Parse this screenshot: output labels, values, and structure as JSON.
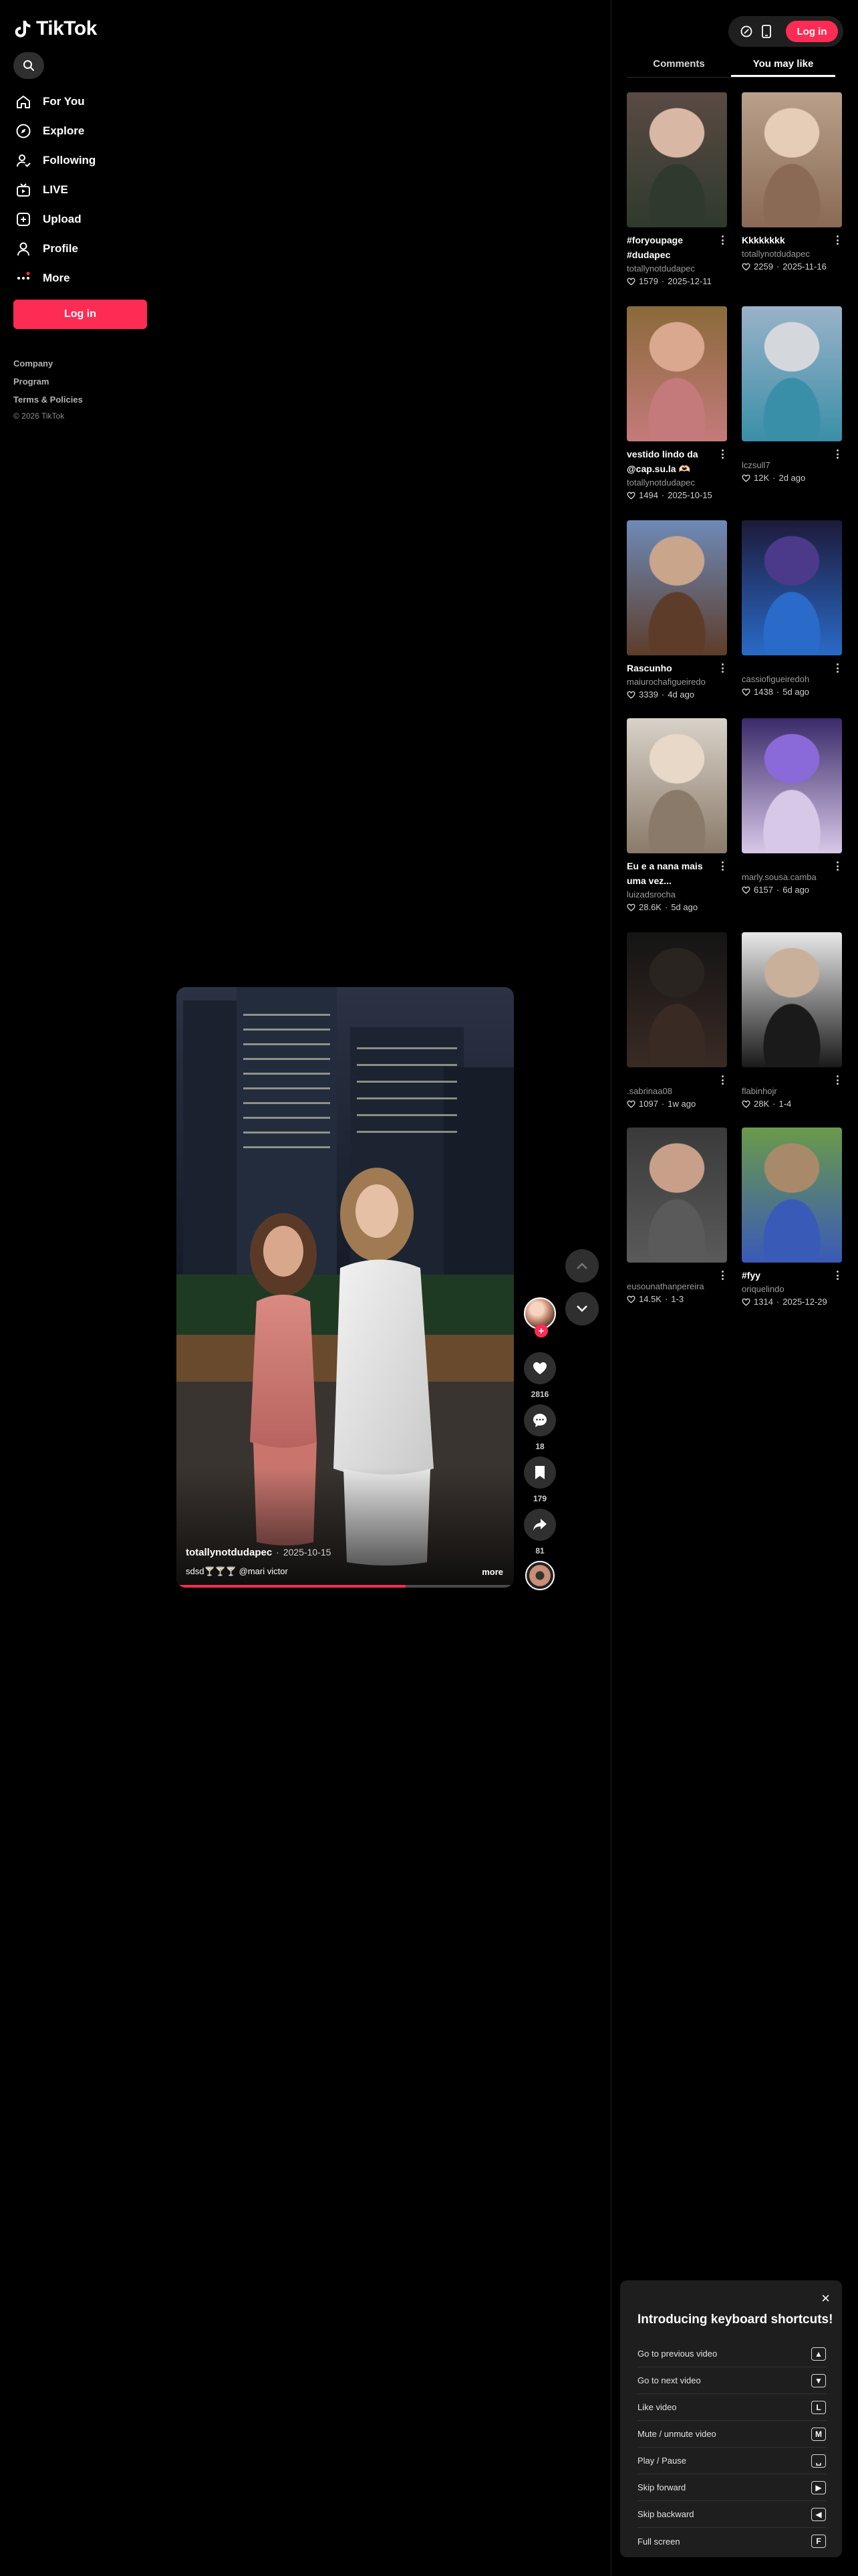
{
  "brand": {
    "name": "TikTok"
  },
  "sidebar": {
    "nav": [
      {
        "label": "For You",
        "icon": "home-icon"
      },
      {
        "label": "Explore",
        "icon": "compass-icon"
      },
      {
        "label": "Following",
        "icon": "following-icon"
      },
      {
        "label": "LIVE",
        "icon": "live-icon"
      },
      {
        "label": "Upload",
        "icon": "upload-icon"
      },
      {
        "label": "Profile",
        "icon": "profile-icon"
      },
      {
        "label": "More",
        "icon": "more-icon"
      }
    ],
    "login_label": "Log in",
    "footer": {
      "company": "Company",
      "program": "Program",
      "terms": "Terms & Policies",
      "copyright": "© 2026 TikTok"
    }
  },
  "video": {
    "author": "totallynotdudapec",
    "separator": "·",
    "date": "2025-10-15",
    "caption": "sdsd🍸🍸🍸 @mari victor",
    "more_label": "more",
    "progress": 0.68,
    "likes": "2816",
    "comments": "18",
    "saves": "179",
    "shares": "81"
  },
  "topbar": {
    "login_label": "Log in"
  },
  "tabs": [
    {
      "label": "Comments"
    },
    {
      "label": "You may like"
    }
  ],
  "recommendations": [
    {
      "title": "#foryoupage #dudapec",
      "author": "totallynotdudapec",
      "likes": "1579",
      "date": "2025-12-11",
      "colors": [
        "#5a4a44",
        "#d9b7a5",
        "#2f3a2c"
      ]
    },
    {
      "title": "Kkkkkkkk",
      "author": "totallynotdudapec",
      "likes": "2259",
      "date": "2025-11-16",
      "colors": [
        "#b8a08a",
        "#e6cdb8",
        "#8a6a55"
      ]
    },
    {
      "title": "vestido lindo da @cap.su.la 🫶🏻",
      "author": "totallynotdudapec",
      "likes": "1494",
      "date": "2025-10-15",
      "colors": [
        "#8a6a3a",
        "#d9a88f",
        "#c47a7a"
      ]
    },
    {
      "title": "",
      "author": "lczsull7",
      "likes": "12K",
      "date": "2d ago",
      "colors": [
        "#9ab2c8",
        "#d4d8dc",
        "#3a8fa8"
      ]
    },
    {
      "title": "Rascunho",
      "author": "maiurochafigueiredo",
      "likes": "3339",
      "date": "4d ago",
      "colors": [
        "#6e8ab8",
        "#c9a58c",
        "#5d3d2a"
      ]
    },
    {
      "title": "",
      "author": "cassiofigueiredoh",
      "likes": "1438",
      "date": "5d ago",
      "colors": [
        "#1d1a3a",
        "#4b3a8a",
        "#2a6ac8"
      ]
    },
    {
      "title": "Eu e a nana mais uma vez...",
      "author": "luizadsrocha",
      "likes": "28.6K",
      "date": "5d ago",
      "colors": [
        "#d8d2c8",
        "#e8d8c8",
        "#8a7a6a"
      ]
    },
    {
      "title": "",
      "author": "marly.sousa.camba",
      "likes": "6157",
      "date": "6d ago",
      "colors": [
        "#3a2a6a",
        "#8a6ad8",
        "#d8c8e8"
      ]
    },
    {
      "title": "",
      "author": ".sabrinaa08",
      "likes": "1097",
      "date": "1w ago",
      "colors": [
        "#141414",
        "#2a2420",
        "#3a2a24"
      ]
    },
    {
      "title": "",
      "author": "flabinhojr",
      "likes": "28K",
      "date": "1-4",
      "colors": [
        "#e8e8e8",
        "#c9b09a",
        "#1a1a1a"
      ]
    },
    {
      "title": "",
      "author": "eusounathanpereira",
      "likes": "14.5K",
      "date": "1-3",
      "colors": [
        "#3a3a3a",
        "#c8a08a",
        "#5a5a5a"
      ]
    },
    {
      "title": "#fyy",
      "author": "oriquelindo",
      "likes": "1314",
      "date": "2025-12-29",
      "colors": [
        "#6a9a4a",
        "#a88a6a",
        "#3a5ab8"
      ]
    }
  ],
  "shortcuts": {
    "close_label": "×",
    "title": "Introducing keyboard shortcuts!",
    "items": [
      {
        "label": "Go to previous video",
        "key": "▲"
      },
      {
        "label": "Go to next video",
        "key": "▼"
      },
      {
        "label": "Like video",
        "key": "L"
      },
      {
        "label": "Mute / unmute video",
        "key": "M"
      },
      {
        "label": "Play / Pause",
        "key": "␣"
      },
      {
        "label": "Skip forward",
        "key": "▶"
      },
      {
        "label": "Skip backward",
        "key": "◀"
      },
      {
        "label": "Full screen",
        "key": "F"
      }
    ]
  },
  "colors": {
    "accent": "#fe2c55",
    "background": "#000000",
    "panel": "#1e1e1e"
  }
}
